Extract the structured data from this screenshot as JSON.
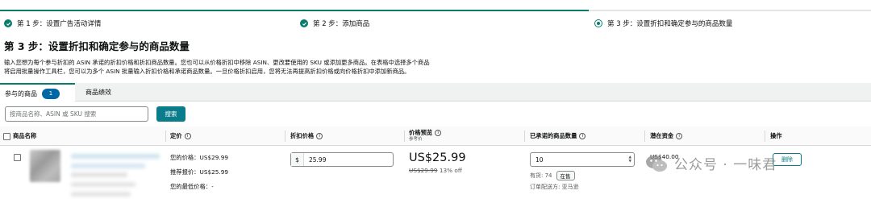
{
  "steps": [
    {
      "label": "第 1 步：设置广告活动详情",
      "state": "done"
    },
    {
      "label": "第 2 步：添加商品",
      "state": "done"
    },
    {
      "label": "第 3 步：设置折扣和确定参与的商品数量",
      "state": "current"
    }
  ],
  "page": {
    "title": "第 3 步：设置折扣和确定参与的商品数量",
    "desc_line1": "输入您想为每个参与折扣的 ASIN 承诺的折扣价格和折扣商品数量。您也可以从价格折扣中移除 ASIN、更改要使用的 SKU 或添加更多商品。在表格中选择多个商品",
    "desc_line2": "将启用批量操作工具栏，您可以为多个 ASIN 批量输入折扣价格和承诺商品数量。一旦价格折扣启用，您将无法再提高折扣价格或向价格折扣中添加新商品。"
  },
  "tabs": [
    {
      "label": "参与的商品",
      "badge": "1"
    },
    {
      "label": "商品绩效"
    }
  ],
  "search": {
    "placeholder": "按商品名称、ASIN 或 SKU 搜索",
    "button": "搜索"
  },
  "table": {
    "headers": {
      "name": "商品名称",
      "list_price": "定价",
      "discount_price": "折扣价格",
      "preview": "价格预览",
      "preview_sub": "参考价",
      "committed_qty": "已承诺的商品数量",
      "potential_funds": "潜在资金",
      "actions": "操作"
    },
    "row": {
      "your_price": "您的价格：US$29.99",
      "recommended_price": "推荐报价：US$25.99",
      "lowest_price": "您的最低价格：-",
      "currency": "$",
      "discount_value": "25.99",
      "preview_price": "US$25.99",
      "preview_old": "US$29.99",
      "preview_off": "13% off",
      "qty_value": "10",
      "stock_label": "有货: 74",
      "stock_status": "在售",
      "ship_label": "订单配送方: 亚马逊",
      "funds": "US$40.00",
      "delete": "删除"
    }
  },
  "watermark": {
    "text": "公众号 · 一味君"
  },
  "colors": {
    "accent": "#0a7c6e",
    "button": "#0a7c8c",
    "badge": "#0067a5"
  }
}
